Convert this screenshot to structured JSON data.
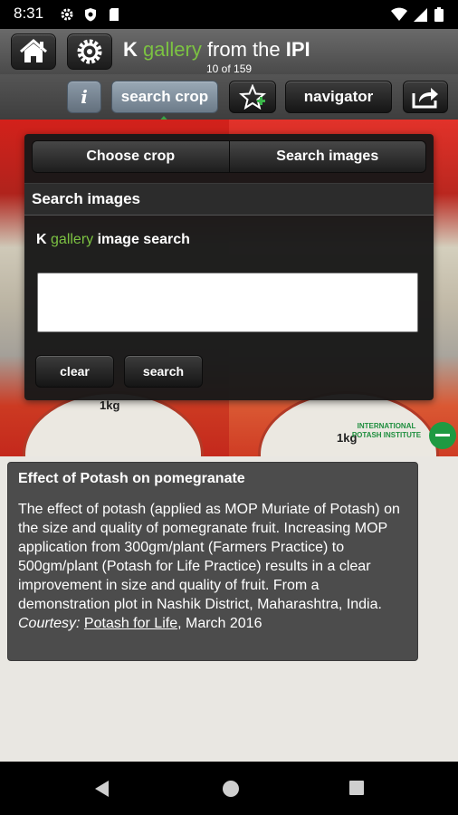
{
  "status_bar": {
    "time": "8:31"
  },
  "header": {
    "title_k": "K",
    "title_gallery": "gallery",
    "title_from": " from the ",
    "title_ipi": "IPI",
    "counter": "10 of 159"
  },
  "toolbar": {
    "info_label": "i",
    "search_crop_label": "search crop",
    "navigator_label": "navigator"
  },
  "photo": {
    "scale_left_label": "1kg",
    "scale_right_label": "1kg",
    "logo_text": "INTERNATIONAL POTASH INSTITUTE"
  },
  "search_panel": {
    "tabs": [
      "Choose crop",
      "Search images"
    ],
    "section_title": "Search images",
    "search_title_k": "K",
    "search_title_gallery": "gallery",
    "search_title_rest": "image search",
    "input_value": "",
    "input_placeholder": "",
    "clear_label": "clear",
    "search_label": "search"
  },
  "caption": {
    "title": "Effect of Potash on pomegranate",
    "text": "The effect of potash (applied as MOP Muriate of Potash) on the size and quality of pomegranate fruit. Increasing MOP application from 300gm/plant (Farmers Practice) to 500gm/plant (Potash for Life Practice) results in a clear improvement in size and quality of fruit. From a demonstration plot in Nashik District, Maharashtra, India. ",
    "courtesy": "Courtesy:",
    "link": "Potash for Life",
    "date": ", March 2016"
  },
  "colors": {
    "brand_green": "#7cc242",
    "active_button": "#8a98a6",
    "panel_bg": "#181818"
  }
}
